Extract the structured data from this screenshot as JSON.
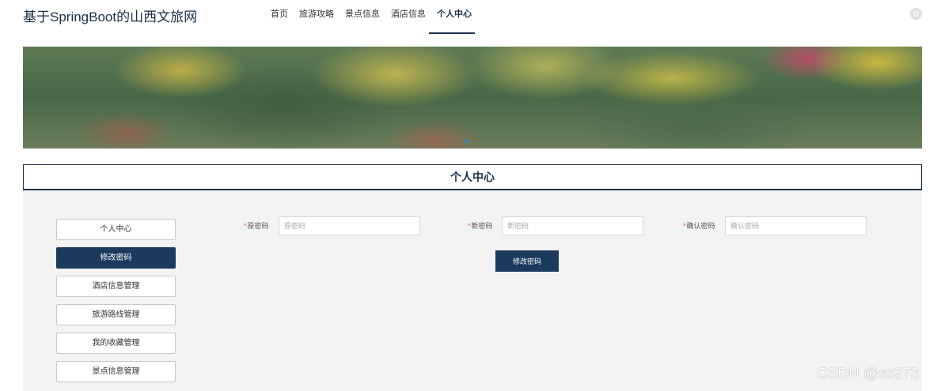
{
  "header": {
    "site_title": "基于SpringBoot的山西文旅网",
    "nav": [
      {
        "label": "首页",
        "active": false
      },
      {
        "label": "旅游攻略",
        "active": false
      },
      {
        "label": "景点信息",
        "active": false
      },
      {
        "label": "酒店信息",
        "active": false
      },
      {
        "label": "个人中心",
        "active": true
      }
    ],
    "power_icon": "power-icon"
  },
  "section": {
    "title": "个人中心"
  },
  "sidebar": {
    "items": [
      {
        "label": "个人中心",
        "active": false
      },
      {
        "label": "修改密码",
        "active": true
      },
      {
        "label": "酒店信息管理",
        "active": false
      },
      {
        "label": "旅游路线管理",
        "active": false
      },
      {
        "label": "我的收藏管理",
        "active": false
      },
      {
        "label": "景点信息管理",
        "active": false
      }
    ]
  },
  "form": {
    "old_password": {
      "required_mark": "*",
      "label": "原密码",
      "placeholder": "原密码",
      "value": ""
    },
    "new_password": {
      "required_mark": "*",
      "label": "新密码",
      "placeholder": "新密码",
      "value": ""
    },
    "confirm_password": {
      "required_mark": "*",
      "label": "确认密码",
      "placeholder": "确认密码",
      "value": ""
    },
    "submit_label": "修改密码"
  },
  "watermark": "CSDN @ss273",
  "colors": {
    "primary": "#1b3a5e",
    "title": "#1b2f4a",
    "required": "#e44444",
    "banner_dot": "#2e8bd6"
  }
}
